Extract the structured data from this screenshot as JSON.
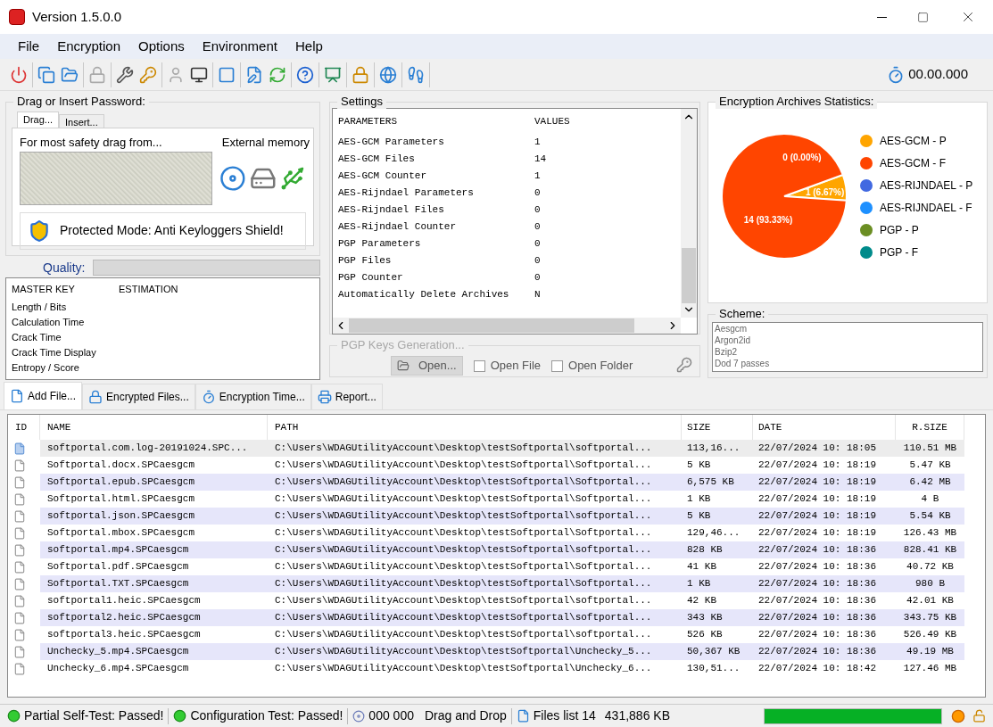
{
  "window": {
    "title": "Version 1.5.0.0"
  },
  "menu": [
    "File",
    "Encryption",
    "Options",
    "Environment",
    "Help"
  ],
  "toolbar": {
    "timer": "00.00.000"
  },
  "password": {
    "title": "Drag or Insert Password:",
    "tabs": [
      {
        "label": "Drag...",
        "selected": true
      },
      {
        "label": "Insert...",
        "selected": false
      }
    ],
    "drag_hint": "For most safety drag from...",
    "external_label": "External memory",
    "protected_mode": "Protected Mode: Anti Keyloggers Shield!"
  },
  "quality": {
    "label": "Quality:"
  },
  "master_key": {
    "columns": [
      "MASTER KEY",
      "ESTIMATION"
    ],
    "rows": [
      "Length / Bits",
      "Calculation Time",
      "Crack Time",
      "Crack Time Display",
      "Entropy / Score"
    ]
  },
  "settings": {
    "title": "Settings",
    "columns": [
      "PARAMETERS",
      "VALUES"
    ],
    "rows": [
      [
        "AES-GCM Parameters",
        "1"
      ],
      [
        "AES-GCM Files",
        "14"
      ],
      [
        "AES-GCM Counter",
        "1"
      ],
      [
        "AES-Rijndael Parameters",
        "0"
      ],
      [
        "AES-Rijndael Files",
        "0"
      ],
      [
        "AES-Rijndael Counter",
        "0"
      ],
      [
        "PGP Parameters",
        "0"
      ],
      [
        "PGP Files",
        "0"
      ],
      [
        "PGP Counter",
        "0"
      ],
      [
        "Automatically Delete Archives",
        "N"
      ]
    ]
  },
  "pgp": {
    "title": "PGP Keys Generation...",
    "open_button": "Open...",
    "options": [
      {
        "label": "Open File",
        "checked": false
      },
      {
        "label": "Open Folder",
        "checked": false
      }
    ]
  },
  "statistics": {
    "title": "Encryption Archives Statistics:",
    "legend": [
      {
        "color": "#ffa500"
      },
      {
        "color": "#ff4500"
      },
      {
        "color": "#4169e1"
      },
      {
        "color": "#1e90ff"
      },
      {
        "color": "#6b8e23"
      },
      {
        "color": "#008b8b"
      }
    ],
    "chart_data": {
      "type": "pie",
      "categories": [
        "AES-GCM - P",
        "AES-GCM - F",
        "AES-RIJNDAEL - P",
        "AES-RIJNDAEL - F",
        "PGP - P",
        "PGP - F"
      ],
      "values": [
        1,
        14,
        0,
        0,
        0,
        0
      ],
      "value_labels": [
        "1 (6.67%)",
        "14 (93.33%)",
        "0 (0.00%)",
        null,
        null,
        null
      ]
    }
  },
  "scheme": {
    "title": "Scheme:",
    "items": [
      "Aesgcm",
      "Argon2id",
      "Bzip2",
      "Dod 7 passes"
    ]
  },
  "file_tabs": [
    {
      "label": "Add File...",
      "selected": true
    },
    {
      "label": "Encrypted Files...",
      "selected": false
    },
    {
      "label": "Encryption Time...",
      "selected": false
    },
    {
      "label": "Report...",
      "selected": false
    }
  ],
  "table": {
    "columns": [
      "ID",
      "NAME",
      "PATH",
      "SIZE",
      "DATE",
      "R.SIZE"
    ],
    "rows": [
      {
        "name": "softportal.com.log-20191024.SPC...",
        "path": "C:\\Users\\WDAGUtilityAccount\\Desktop\\testSoftportal\\softportal...",
        "size": "113,16...",
        "date": "22/07/2024 10: 18:05",
        "rsize": "110.51 MB",
        "selected": true
      },
      {
        "name": "Softportal.docx.SPCaesgcm",
        "path": "C:\\Users\\WDAGUtilityAccount\\Desktop\\testSoftportal\\Softportal...",
        "size": "5 KB",
        "date": "22/07/2024 10: 18:19",
        "rsize": "5.47 KB",
        "selected": false
      },
      {
        "name": "Softportal.epub.SPCaesgcm",
        "path": "C:\\Users\\WDAGUtilityAccount\\Desktop\\testSoftportal\\Softportal...",
        "size": "6,575 KB",
        "date": "22/07/2024 10: 18:19",
        "rsize": "6.42 MB",
        "selected": false
      },
      {
        "name": "Softportal.html.SPCaesgcm",
        "path": "C:\\Users\\WDAGUtilityAccount\\Desktop\\testSoftportal\\Softportal...",
        "size": "1 KB",
        "date": "22/07/2024 10: 18:19",
        "rsize": "4 B",
        "selected": false
      },
      {
        "name": "softportal.json.SPCaesgcm",
        "path": "C:\\Users\\WDAGUtilityAccount\\Desktop\\testSoftportal\\softportal...",
        "size": "5 KB",
        "date": "22/07/2024 10: 18:19",
        "rsize": "5.54 KB",
        "selected": false
      },
      {
        "name": "Softportal.mbox.SPCaesgcm",
        "path": "C:\\Users\\WDAGUtilityAccount\\Desktop\\testSoftportal\\Softportal...",
        "size": "129,46...",
        "date": "22/07/2024 10: 18:19",
        "rsize": "126.43 MB",
        "selected": false
      },
      {
        "name": "softportal.mp4.SPCaesgcm",
        "path": "C:\\Users\\WDAGUtilityAccount\\Desktop\\testSoftportal\\softportal...",
        "size": "828 KB",
        "date": "22/07/2024 10: 18:36",
        "rsize": "828.41 KB",
        "selected": false
      },
      {
        "name": "Softportal.pdf.SPCaesgcm",
        "path": "C:\\Users\\WDAGUtilityAccount\\Desktop\\testSoftportal\\Softportal...",
        "size": "41 KB",
        "date": "22/07/2024 10: 18:36",
        "rsize": "40.72 KB",
        "selected": false
      },
      {
        "name": "Softportal.TXT.SPCaesgcm",
        "path": "C:\\Users\\WDAGUtilityAccount\\Desktop\\testSoftportal\\Softportal...",
        "size": "1 KB",
        "date": "22/07/2024 10: 18:36",
        "rsize": "980 B",
        "selected": false
      },
      {
        "name": "softportal1.heic.SPCaesgcm",
        "path": "C:\\Users\\WDAGUtilityAccount\\Desktop\\testSoftportal\\softportal...",
        "size": "42 KB",
        "date": "22/07/2024 10: 18:36",
        "rsize": "42.01 KB",
        "selected": false
      },
      {
        "name": "softportal2.heic.SPCaesgcm",
        "path": "C:\\Users\\WDAGUtilityAccount\\Desktop\\testSoftportal\\softportal...",
        "size": "343 KB",
        "date": "22/07/2024 10: 18:36",
        "rsize": "343.75 KB",
        "selected": false
      },
      {
        "name": "softportal3.heic.SPCaesgcm",
        "path": "C:\\Users\\WDAGUtilityAccount\\Desktop\\testSoftportal\\softportal...",
        "size": "526 KB",
        "date": "22/07/2024 10: 18:36",
        "rsize": "526.49 KB",
        "selected": false
      },
      {
        "name": "Unchecky_5.mp4.SPCaesgcm",
        "path": "C:\\Users\\WDAGUtilityAccount\\Desktop\\testSoftportal\\Unchecky_5...",
        "size": "50,367 KB",
        "date": "22/07/2024 10: 18:36",
        "rsize": "49.19 MB",
        "selected": false
      },
      {
        "name": "Unchecky_6.mp4.SPCaesgcm",
        "path": "C:\\Users\\WDAGUtilityAccount\\Desktop\\testSoftportal\\Unchecky_6...",
        "size": "130,51...",
        "date": "22/07/2024 10: 18:42",
        "rsize": "127.46 MB",
        "selected": false
      }
    ]
  },
  "status_bar": {
    "self_test": "Partial Self-Test: Passed!",
    "config_test": "Configuration Test: Passed!",
    "counter": "000 000",
    "drag_drop": "Drag and Drop",
    "files_list": "Files list 14",
    "total_size": "431,886 KB",
    "progress": {
      "level": 1
    }
  }
}
